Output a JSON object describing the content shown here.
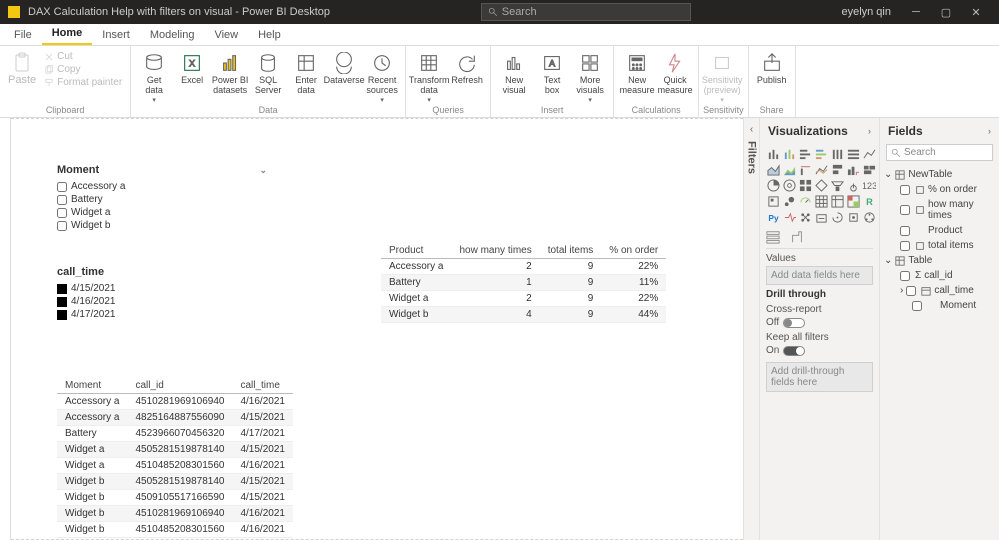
{
  "titlebar": {
    "title": "DAX Calculation Help with filters on visual - Power BI Desktop",
    "search_placeholder": "Search",
    "user": "eyelyn qin"
  },
  "tabs": {
    "file": "File",
    "home": "Home",
    "insert": "Insert",
    "modeling": "Modeling",
    "view": "View",
    "help": "Help"
  },
  "ribbon": {
    "clipboard": {
      "paste": "Paste",
      "cut": "Cut",
      "copy": "Copy",
      "format_painter": "Format painter",
      "caption": "Clipboard"
    },
    "data": {
      "get_data": "Get\ndata",
      "excel": "Excel",
      "pbi_ds": "Power BI\ndatasets",
      "sql": "SQL\nServer",
      "enter": "Enter\ndata",
      "dataverse": "Dataverse",
      "recent": "Recent\nsources",
      "caption": "Data"
    },
    "queries": {
      "transform": "Transform\ndata",
      "refresh": "Refresh",
      "caption": "Queries"
    },
    "insert": {
      "new_visual": "New\nvisual",
      "text_box": "Text\nbox",
      "more": "More\nvisuals",
      "caption": "Insert"
    },
    "calcs": {
      "new_measure": "New\nmeasure",
      "quick": "Quick\nmeasure",
      "caption": "Calculations"
    },
    "sens": {
      "label": "Sensitivity\n(preview)",
      "caption": "Sensitivity"
    },
    "share": {
      "publish": "Publish",
      "caption": "Share"
    }
  },
  "filters_label": "Filters",
  "viz_pane": {
    "header": "Visualizations",
    "values": "Values",
    "values_placeholder": "Add data fields here",
    "drill": "Drill through",
    "cross": "Cross-report",
    "off": "Off",
    "keep": "Keep all filters",
    "on": "On",
    "drill_placeholder": "Add drill-through fields here"
  },
  "fields_pane": {
    "header": "Fields",
    "search": "Search",
    "table1": "NewTable",
    "t1_f1": "% on order",
    "t1_f2": "how many times",
    "t1_f3": "Product",
    "t1_f4": "total items",
    "table2": "Table",
    "t2_f1": "call_id",
    "t2_f2": "call_time",
    "t2_f3": "Moment"
  },
  "slicer_moment": {
    "title": "Moment",
    "items": [
      "Accessory a",
      "Battery",
      "Widget a",
      "Widget b"
    ]
  },
  "slicer_calltime": {
    "title": "call_time",
    "items": [
      "4/15/2021",
      "4/16/2021",
      "4/17/2021"
    ]
  },
  "summary_table": {
    "headers": {
      "product": "Product",
      "hmt": "how many times",
      "total": "total items",
      "pct": "% on order"
    },
    "rows": [
      {
        "product": "Accessory a",
        "hmt": "2",
        "total": "9",
        "pct": "22%"
      },
      {
        "product": "Battery",
        "hmt": "1",
        "total": "9",
        "pct": "11%"
      },
      {
        "product": "Widget a",
        "hmt": "2",
        "total": "9",
        "pct": "22%"
      },
      {
        "product": "Widget b",
        "hmt": "4",
        "total": "9",
        "pct": "44%"
      }
    ]
  },
  "detail_table": {
    "headers": {
      "moment": "Moment",
      "call_id": "call_id",
      "call_time": "call_time"
    },
    "rows": [
      {
        "moment": "Accessory a",
        "call_id": "4510281969106940",
        "call_time": "4/16/2021"
      },
      {
        "moment": "Accessory a",
        "call_id": "4825164887556090",
        "call_time": "4/15/2021"
      },
      {
        "moment": "Battery",
        "call_id": "4523966070456320",
        "call_time": "4/17/2021"
      },
      {
        "moment": "Widget a",
        "call_id": "4505281519878140",
        "call_time": "4/15/2021"
      },
      {
        "moment": "Widget a",
        "call_id": "4510485208301560",
        "call_time": "4/16/2021"
      },
      {
        "moment": "Widget b",
        "call_id": "4505281519878140",
        "call_time": "4/15/2021"
      },
      {
        "moment": "Widget b",
        "call_id": "4509105517166590",
        "call_time": "4/15/2021"
      },
      {
        "moment": "Widget b",
        "call_id": "4510281969106940",
        "call_time": "4/16/2021"
      },
      {
        "moment": "Widget b",
        "call_id": "4510485208301560",
        "call_time": "4/16/2021"
      }
    ]
  }
}
